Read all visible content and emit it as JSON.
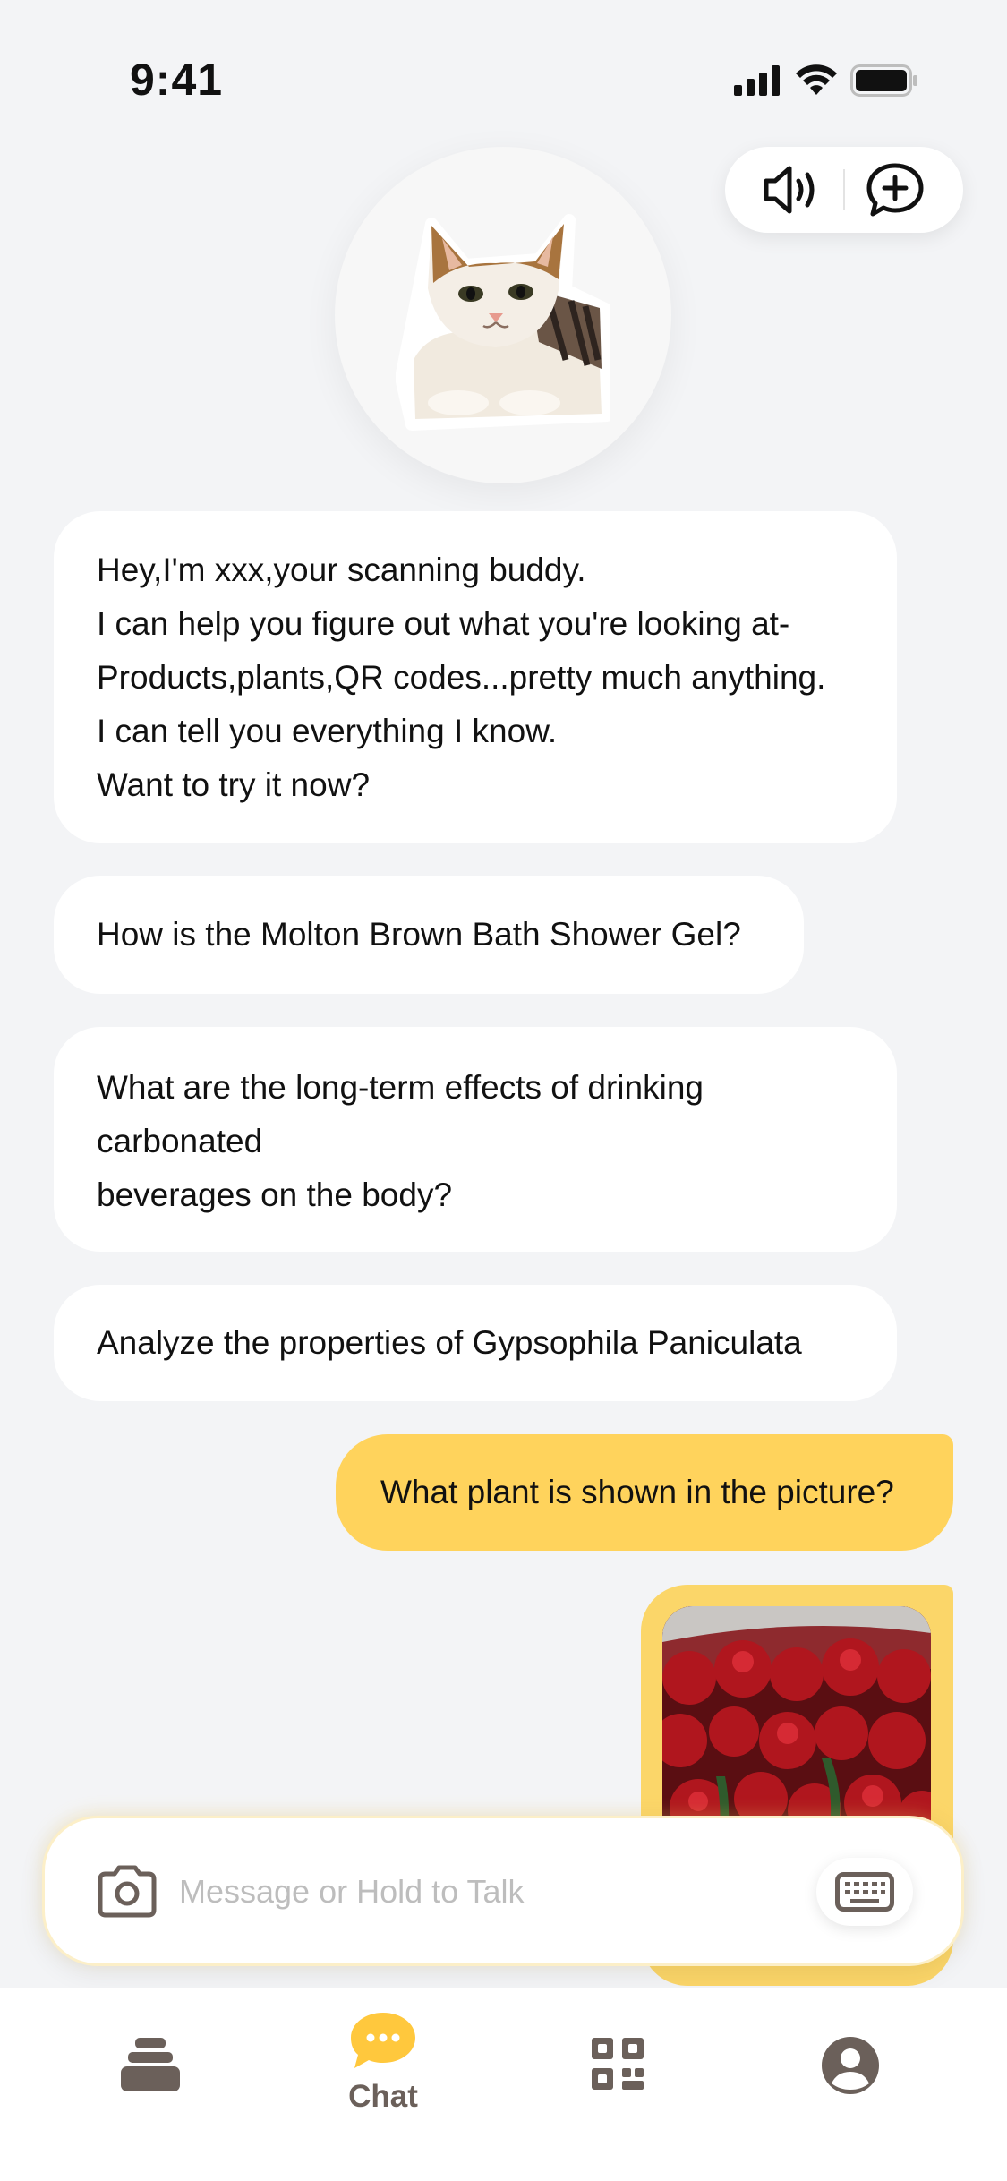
{
  "status_bar": {
    "time": "9:41"
  },
  "header": {
    "sound_icon": "speaker-icon",
    "new_chat_icon": "chat-plus-icon",
    "avatar_alt": "cat-avatar"
  },
  "messages": {
    "welcome": {
      "lines": [
        "Hey,I'm xxx,your scanning buddy.",
        "I can help you figure out what you're looking at-",
        "Products,plants,QR codes...pretty much anything.",
        "I can tell you everything I know.",
        "Want to try it now?"
      ]
    },
    "suggestions": [
      {
        "lines": [
          "How is the Molton Brown Bath Shower Gel?"
        ]
      },
      {
        "lines": [
          "What are the long-term effects of drinking",
          "carbonated",
          "beverages on the body?"
        ]
      },
      {
        "lines": [
          "Analyze the properties of Gypsophila Paniculata"
        ]
      }
    ],
    "user": {
      "text": "What plant is shown in the picture?"
    }
  },
  "composer": {
    "placeholder": "Message or Hold to Talk",
    "value": "",
    "camera_icon": "camera-icon",
    "keyboard_icon": "keyboard-icon"
  },
  "tab_bar": {
    "items": [
      {
        "name": "home",
        "icon": "stack-icon",
        "label": ""
      },
      {
        "name": "chat",
        "icon": "chat-bubble-icon",
        "label": "Chat",
        "active": true
      },
      {
        "name": "scan",
        "icon": "qr-code-icon",
        "label": ""
      },
      {
        "name": "profile",
        "icon": "profile-icon",
        "label": ""
      }
    ]
  },
  "colors": {
    "background": "#F3F4F6",
    "bubble": "#FFFFFF",
    "user_bubble": "#FFD35C",
    "accent": "#FFC83D",
    "icon_brown": "#6B605A",
    "placeholder": "#BDBDBD"
  }
}
